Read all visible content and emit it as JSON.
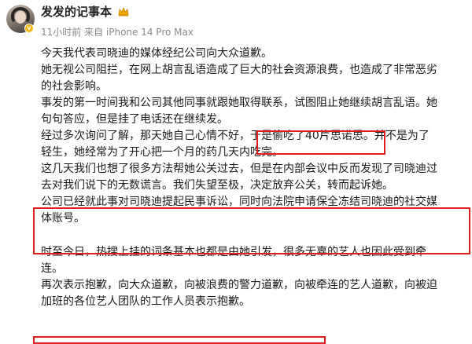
{
  "post": {
    "username": "发发的记事本",
    "meta": "11小时前  来自 iPhone 14 Pro Max",
    "lines_a": [
      "今天我代表司晓迪的媒体经纪公司向大众道歉。",
      "她无视公司阻拦，在网上胡言乱语造成了巨大的社会资源浪费，也造成了非常恶劣",
      "的社会影响。",
      "事发的第一时间我和公司其他同事就跟她取得联系，试图阻止她继续胡言乱语。她",
      "句句答应，但是挂了电话还在继续发。"
    ],
    "line6": {
      "before": "经过多次询问了解，那天她自己心情不好，",
      "highlight": "于是偷吃了40片思诺思。",
      "after": "并不是为了"
    },
    "lines_b": [
      "轻生，她经常为了开心把一个月的药几天内吃完。",
      "这几天我们也想了很多方法帮她公关过去，但是在内部会议中反而发现了司晓迪过",
      "去对我们说下的无数谎言。我们失望至极，决定放弃公关，转而起诉她。"
    ],
    "lines_c": [
      "公司已经就此事对司晓迪提起民事诉讼，同时向法院申请保全冻结司晓迪的社交媒",
      "体账号。"
    ],
    "lines_d": [
      "时至今日，热搜上挂的词条基本也都是由她引发，很多无辜的艺人也因此受到牵",
      "连。",
      "再次表示抱歉，向大众道歉，向被浪费的警力道歉，向被牵连的艺人道歉，向被迫",
      "加班的各位艺人团队的工作人员表示抱歉。"
    ]
  },
  "colors": {
    "highlight_box": "#e01d1d",
    "meta_text": "#8a8a8a",
    "verified_badge": "#f5b400"
  }
}
